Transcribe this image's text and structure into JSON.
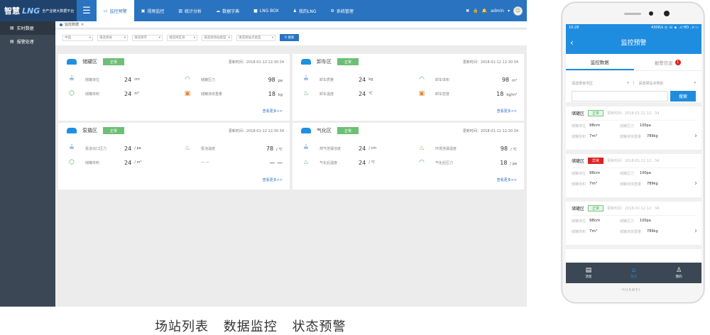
{
  "desktop": {
    "brand": {
      "logo_part1": "智慧",
      "logo_part2": "LNG",
      "subtitle": "全产业链大数据平台"
    },
    "nav": [
      "监控预警",
      "视频监控",
      "统计分析",
      "数据字典",
      "LNG BOX",
      "我的LNG",
      "系统管理"
    ],
    "user": "admin",
    "sidebar": [
      "实时数据",
      "报警处理"
    ],
    "breadcrumb": "监控数据",
    "filters": [
      "中国",
      "请选择省",
      "请选择市",
      "请选择区县",
      "请选择场站类型",
      "请选择站点类型"
    ],
    "search_label": "搜索",
    "more_label": "查看更多>>",
    "cards": [
      {
        "title": "储罐区",
        "status": "正常",
        "time": "更新时间：2018-01-12 12:30:34",
        "rows": [
          {
            "l_label": "储罐液位",
            "l_val": "24",
            "l_unit": "cm",
            "r_label": "储罐压力",
            "r_val": "98",
            "r_unit": "pa"
          },
          {
            "l_label": "储罐体积",
            "l_val": "24",
            "l_unit": "m³",
            "r_label": "储罐液体重量",
            "r_val": "18",
            "r_unit": "kg"
          }
        ]
      },
      {
        "title": "卸车区",
        "status": "正常",
        "time": "更新时间：2018-01-12 12:30:34",
        "rows": [
          {
            "l_label": "卸车质量",
            "l_val": "24",
            "l_unit": "kg",
            "r_label": "卸车体积",
            "r_val": "98",
            "r_unit": "m³"
          },
          {
            "l_label": "卸车温度",
            "l_val": "24",
            "l_unit": "℃",
            "r_label": "卸车密度",
            "r_val": "18",
            "r_unit": "kg/m³"
          }
        ]
      },
      {
        "title": "泵撬区",
        "status": "正常",
        "time": "更新时间：2018-01-12 12:30:34",
        "rows": [
          {
            "l_label": "泵进出口压力",
            "l_val": "24",
            "l_unit": "/ pa",
            "r_label": "泵池温度",
            "r_val": "78",
            "r_unit": "/ ℃"
          },
          {
            "l_label": "储罐体积",
            "l_val": "24",
            "l_unit": "/ m³",
            "r_label": "— —",
            "r_val": "— —",
            "r_unit": ""
          }
        ]
      },
      {
        "title": "气化区",
        "status": "正常",
        "time": "更新时间：2018-01-12 12:30:34",
        "rows": [
          {
            "l_label": "燃气泄漏浓度",
            "l_val": "24",
            "l_unit": "/ cm",
            "r_label": "环境泄漏温度",
            "r_val": "98",
            "r_unit": "/ ℃"
          },
          {
            "l_label": "气化后温度",
            "l_val": "24",
            "l_unit": "/ ℃",
            "r_label": "气化后压力",
            "r_val": "18",
            "r_unit": "/ pa"
          }
        ]
      }
    ]
  },
  "caption": [
    "场站列表",
    "数据监控",
    "状态预警"
  ],
  "phone": {
    "status_time": "10:28",
    "status_right": "430K/s ◷ ☏ ◈ ..ıl HD ..ıl ▭",
    "title": "监控预警",
    "tabs": [
      "监控数据",
      "报警信息"
    ],
    "alert_count": "1",
    "filter_left": "请选择省市区",
    "filter_right": "请选择站点类别",
    "search_label": "搜索",
    "cards": [
      {
        "name": "储罐区",
        "status": "正常",
        "status_kind": "ok",
        "time": "更新时间：2018-01-12 12：34",
        "r1": [
          "储罐液位",
          "98cm",
          "储罐压力",
          "100pa"
        ],
        "r2": [
          "储罐体积",
          "7m³",
          "储罐液体重量",
          "789kg"
        ]
      },
      {
        "name": "储罐区",
        "status": "异常",
        "status_kind": "err",
        "time": "更新时间：2018-01-12 12：34",
        "r1": [
          "储罐液位",
          "98cm",
          "储罐压力",
          "100pa"
        ],
        "r2": [
          "储罐体积",
          "7m³",
          "储罐液体重量",
          "789kg"
        ]
      },
      {
        "name": "储罐区",
        "status": "正常",
        "status_kind": "ok",
        "time": "更新时间：2018-01-12 12：34",
        "r1": [
          "储罐液位",
          "98cm",
          "储罐压力",
          "100pa"
        ],
        "r2": [
          "储罐体积",
          "7m³",
          "储罐液体重量",
          "789kg"
        ]
      }
    ],
    "bottom_nav": [
      "消息",
      "首页",
      "我的"
    ],
    "brand": "HUAWEI"
  }
}
